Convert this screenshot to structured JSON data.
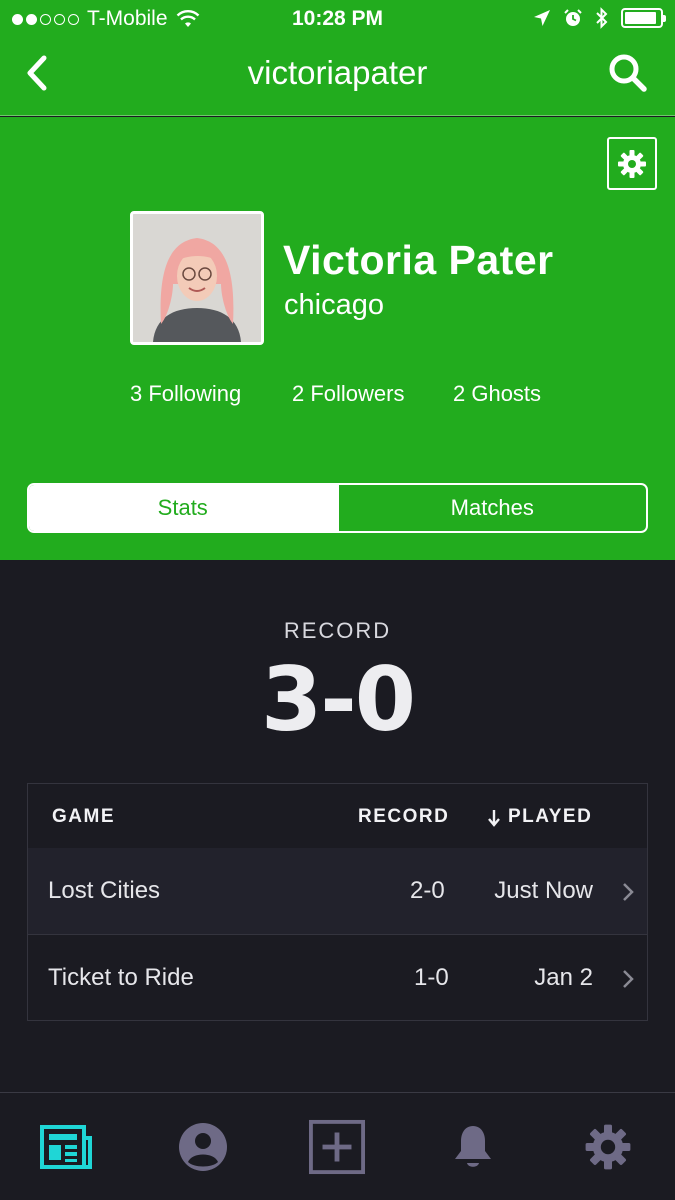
{
  "status_bar": {
    "carrier": "T-Mobile",
    "time": "10:28 PM",
    "signal_bars": 2,
    "signal_total": 5,
    "battery_level": 0.9
  },
  "nav": {
    "title": "victoriapater",
    "back_icon": "chevron-left-icon",
    "search_icon": "search-icon"
  },
  "profile": {
    "name": "Victoria Pater",
    "location": "chicago",
    "following": "3 Following",
    "followers": "2 Followers",
    "ghosts": "2 Ghosts",
    "settings_icon": "gear-icon"
  },
  "tabs": {
    "stats": "Stats",
    "matches": "Matches",
    "active": "Stats"
  },
  "record": {
    "label": "RECORD",
    "value": "3-0"
  },
  "games_table": {
    "headers": {
      "game": "GAME",
      "record": "RECORD",
      "played": "PLAYED"
    },
    "rows": [
      {
        "game": "Lost Cities",
        "record": "2-0",
        "played": "Just Now"
      },
      {
        "game": "Ticket to Ride",
        "record": "1-0",
        "played": "Jan  2"
      }
    ]
  },
  "tab_bar": {
    "items": [
      "news-feed-icon",
      "profile-icon",
      "add-icon",
      "bell-icon",
      "settings-gear-icon"
    ],
    "active_color": "#1fd6d6",
    "inactive_color": "#6e6a86"
  },
  "colors": {
    "brand_green": "#22ac1e",
    "dark_bg": "#1b1b22"
  }
}
